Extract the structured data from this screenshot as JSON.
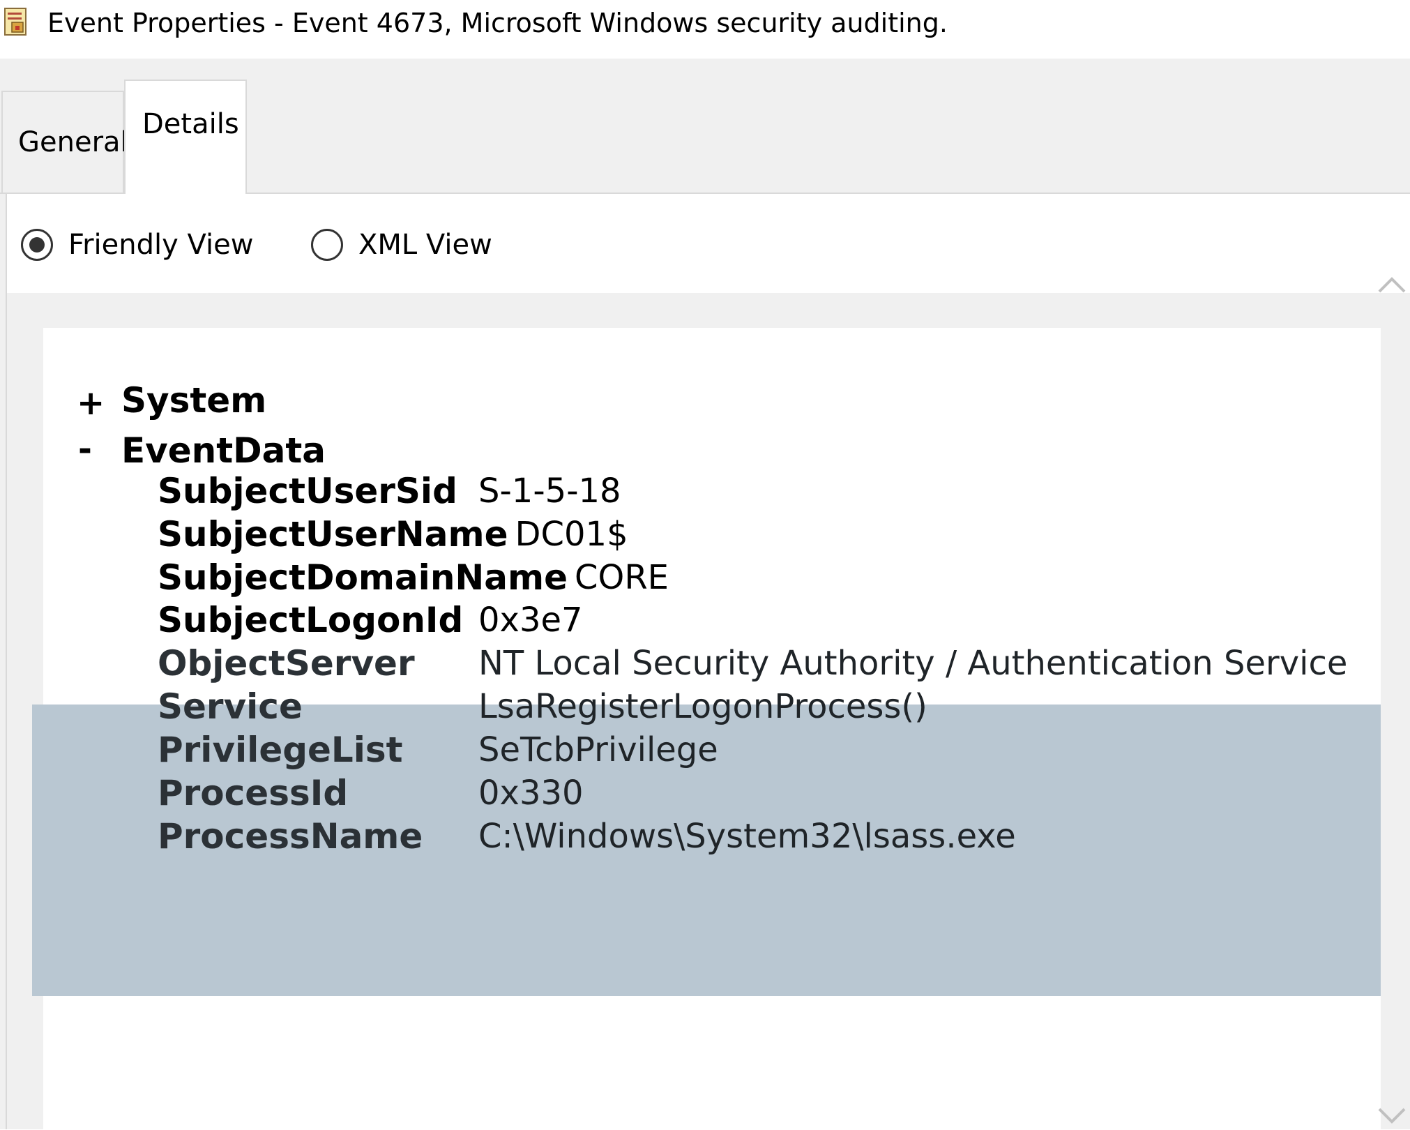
{
  "window": {
    "title": "Event Properties - Event 4673, Microsoft Windows security auditing."
  },
  "tabs": {
    "general": "General",
    "details": "Details"
  },
  "view_options": {
    "friendly": "Friendly View",
    "xml": "XML View",
    "selected": "friendly"
  },
  "tree": {
    "system": {
      "toggle": "+",
      "label": "System"
    },
    "event_data": {
      "toggle": "-",
      "label": "EventData",
      "fields": [
        {
          "key": "SubjectUserSid",
          "value": "S-1-5-18"
        },
        {
          "key": "SubjectUserName",
          "value": "DC01$"
        },
        {
          "key": "SubjectDomainName",
          "value": "CORE"
        },
        {
          "key": "SubjectLogonId",
          "value": "0x3e7"
        },
        {
          "key": "ObjectServer",
          "value": "NT Local Security Authority / Authentication Service"
        },
        {
          "key": "Service",
          "value": "LsaRegisterLogonProcess()"
        },
        {
          "key": "PrivilegeList",
          "value": "SeTcbPrivilege"
        },
        {
          "key": "ProcessId",
          "value": "0x330"
        },
        {
          "key": "ProcessName",
          "value": "C:\\Windows\\System32\\lsass.exe"
        }
      ]
    }
  },
  "colors": {
    "selection": "#b9c7d2",
    "dialog_background": "#f0f0f0"
  }
}
